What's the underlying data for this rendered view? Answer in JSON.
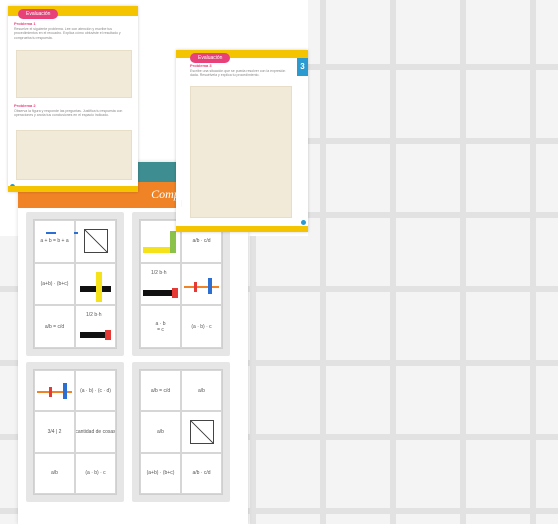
{
  "booklet": {
    "title": "Comprendemos",
    "cards": [
      {
        "cells": [
          {
            "kind": "text",
            "text": "a + b = b + a"
          },
          {
            "kind": "icon",
            "icon": "square-diagonal"
          },
          {
            "kind": "text",
            "text": "(a+b) · (b+c)"
          },
          {
            "kind": "bars",
            "icon": "black-yellow-cross"
          },
          {
            "kind": "text",
            "text": "a/b = c/d"
          },
          {
            "kind": "bars",
            "icon": "black-red-bar-with-text",
            "text": "1/2 b·h"
          }
        ]
      },
      {
        "cells": [
          {
            "kind": "bars",
            "icon": "yellow-green-corner"
          },
          {
            "kind": "text",
            "text": "a/b · c/d"
          },
          {
            "kind": "bars",
            "icon": "black-red-bar-with-text",
            "text": "1/2 b·h"
          },
          {
            "kind": "bars",
            "icon": "orange-blue-line"
          },
          {
            "kind": "text",
            "text": "a · b\n= c"
          },
          {
            "kind": "text",
            "text": "(a · b) · c"
          }
        ]
      },
      {
        "cells": [
          {
            "kind": "bars",
            "icon": "orange-blue-line"
          },
          {
            "kind": "text",
            "text": "(a · b) · (c · d)"
          },
          {
            "kind": "text",
            "text": "3/4 | 2"
          },
          {
            "kind": "text",
            "text": "cantidad de cosas"
          },
          {
            "kind": "text",
            "text": "a/b"
          },
          {
            "kind": "text",
            "text": "(a · b) · c"
          }
        ]
      },
      {
        "cells": [
          {
            "kind": "text",
            "text": "a/b = c/d"
          },
          {
            "kind": "text",
            "text": "a/b"
          },
          {
            "kind": "text",
            "text": "a/b"
          },
          {
            "kind": "icon",
            "icon": "square-diagonal"
          },
          {
            "kind": "text",
            "text": "(a+b) · (b+c)"
          },
          {
            "kind": "text",
            "text": "a/b · c/d"
          }
        ]
      }
    ]
  },
  "pageA": {
    "tab": "Evaluación",
    "heading1": "Problema 1",
    "body1": "Resuelve el siguiente problema. Lee con atención y escribe tus procedimientos en el recuadro. Explica cómo obtuviste el resultado y comprueba tu respuesta.",
    "heading2": "Problema 2",
    "body2": "Observa la figura y responde las preguntas. Justifica tu respuesta con operaciones y anota tus conclusiones en el espacio indicado."
  },
  "pageB": {
    "tab": "Evaluación",
    "heading": "Problema 3",
    "body": "Escribe una situación que se pueda resolver con la expresión dada. Resuélvela y explica tu procedimiento.",
    "badge": "3"
  },
  "colors": {
    "teal": "#3e8e91",
    "orange": "#f08326",
    "yellow": "#f5c400",
    "pink": "#e8417a",
    "blue": "#2a9ad1",
    "beige": "#f2ead9"
  }
}
